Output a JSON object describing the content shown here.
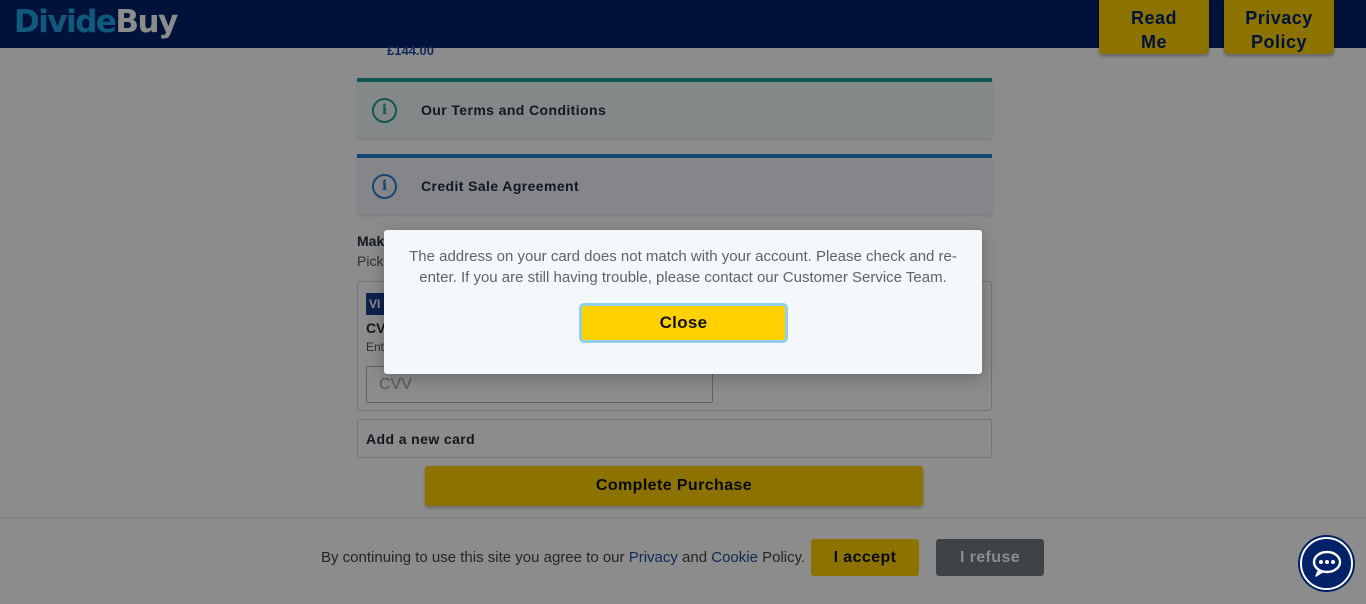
{
  "header": {
    "logo_part1": "Divide",
    "logo_part2": "Buy",
    "read_me_line1": "Read",
    "read_me_line2": "Me",
    "privacy_line1": "Privacy",
    "privacy_line2": "Policy"
  },
  "main": {
    "price": "£144.00",
    "terms_label": "Our Terms and Conditions",
    "credit_label": "Credit Sale Agreement",
    "info_icon_glyph": "i",
    "make_label": "Mak",
    "pick_label": "Pick",
    "card_badge": "VI",
    "cvv_title": "CV",
    "cvv_hint": "Ent",
    "cvv_placeholder": "CVV",
    "add_card_label": "Add a new card",
    "complete_label": "Complete Purchase"
  },
  "cookie": {
    "text_before": "By continuing to use this site you agree to our ",
    "privacy_link": "Privacy",
    "and": " and ",
    "cookie_link": "Cookie",
    "text_after": " Policy.",
    "accept_label": "I accept",
    "refuse_label": "I refuse"
  },
  "modal": {
    "message": "The address on your card does not match with your account. Please check and re-enter. If you are still having trouble, please contact our Customer Service Team.",
    "close_label": "Close"
  },
  "colors": {
    "brand_navy": "#012169",
    "brand_yellow": "#ffd100",
    "terms_accent": "#1f9e99",
    "credit_accent": "#2b7fd4"
  },
  "icons": {
    "info": "info-icon",
    "chat": "chat-icon"
  }
}
